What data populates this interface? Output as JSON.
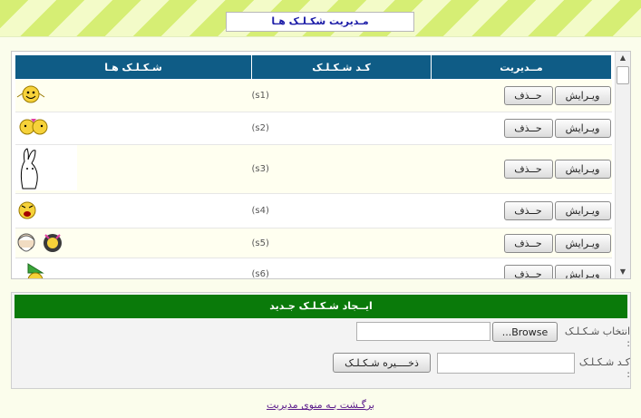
{
  "page": {
    "title": "مـديريت شكـلـک هـا"
  },
  "table": {
    "headers": {
      "smiley": "شـكـلـک هـا",
      "code": "كـد شـكـلـک",
      "actions": "مــديريت"
    },
    "rows": [
      {
        "code": "(s1)"
      },
      {
        "code": "(s2)"
      },
      {
        "code": "(s3)"
      },
      {
        "code": "(s4)"
      },
      {
        "code": "(s5)"
      },
      {
        "code": "(s6)"
      }
    ],
    "edit_label": "ويـرايش",
    "delete_label": "حــذف"
  },
  "form": {
    "header": "ايــجاد شـكـلـک جـديد",
    "file_label": "انتخاب شـكـلـک :",
    "browse_label": "Browse...",
    "code_label": "كـد شـكـلـک :",
    "save_label": "ذخــــيره شـكـلـک"
  },
  "back_link": "برگـشت بـه منوى مديريت",
  "colors": {
    "header_blue": "#0f5c86",
    "header_green": "#0a7a0a",
    "stripe_green": "#d6ee74"
  }
}
